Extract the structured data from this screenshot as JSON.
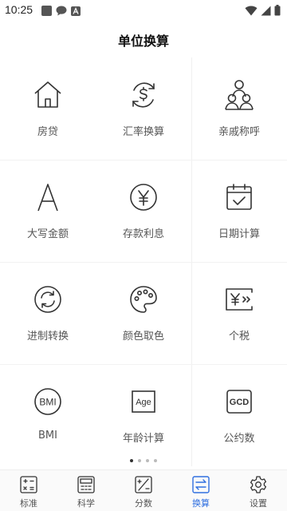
{
  "status": {
    "time": "10:25"
  },
  "page": {
    "title": "单位换算"
  },
  "tools": [
    {
      "label": "房贷",
      "icon": "house-icon"
    },
    {
      "label": "汇率换算",
      "icon": "currency-exchange-icon"
    },
    {
      "label": "亲戚称呼",
      "icon": "family-icon"
    },
    {
      "label": "大写金额",
      "icon": "letter-a-icon"
    },
    {
      "label": "存款利息",
      "icon": "yen-coin-icon"
    },
    {
      "label": "日期计算",
      "icon": "calendar-check-icon"
    },
    {
      "label": "进制转换",
      "icon": "refresh-icon"
    },
    {
      "label": "颜色取色",
      "icon": "palette-icon"
    },
    {
      "label": "个税",
      "icon": "tax-yen-icon"
    },
    {
      "label": "BMI",
      "icon": "bmi-icon",
      "icon_text": "BMI"
    },
    {
      "label": "年龄计算",
      "icon": "age-icon",
      "icon_text": "Age"
    },
    {
      "label": "公约数",
      "icon": "gcd-icon",
      "icon_text": "GCD"
    }
  ],
  "pager": {
    "pages": 4,
    "current": 1
  },
  "tabbar": {
    "tabs": [
      {
        "label": "标准",
        "icon": "calculator-icon"
      },
      {
        "label": "科学",
        "icon": "scientific-calculator-icon"
      },
      {
        "label": "分数",
        "icon": "fraction-icon"
      },
      {
        "label": "换算",
        "icon": "convert-icon",
        "active": true
      },
      {
        "label": "设置",
        "icon": "gear-icon"
      }
    ]
  },
  "colors": {
    "accent": "#2f6fe0",
    "icon": "#333333",
    "label": "#555555"
  }
}
